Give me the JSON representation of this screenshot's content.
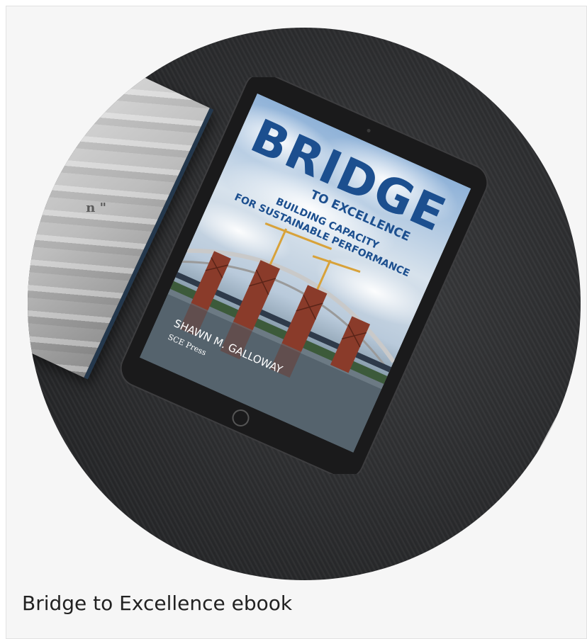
{
  "figure": {
    "caption": "Bridge to Excellence ebook",
    "image_alt": "Tablet displaying ebook cover on dark wooden table",
    "cover": {
      "title": "BRIDGE",
      "subtitle": "TO EXCELLENCE",
      "tagline_line1": "BUILDING CAPACITY",
      "tagline_line2": "FOR SUSTAINABLE PERFORMANCE",
      "author": "SHAWN M. GALLOWAY",
      "publisher": "SCE Press"
    },
    "side_text": "n \""
  },
  "colors": {
    "title_blue": "#1c4f8f",
    "tablet_frame": "#1a1a1b",
    "bridge_rust": "#8a3b2a",
    "background": "#f6f6f6"
  }
}
